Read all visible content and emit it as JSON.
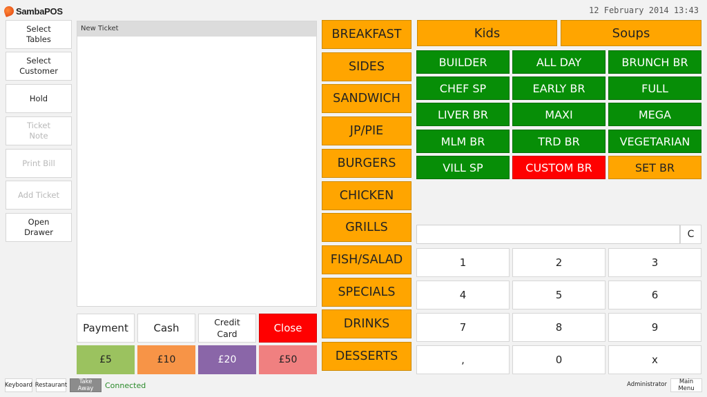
{
  "header": {
    "brand": "SambaPOS",
    "datetime": "12 February 2014 13:43"
  },
  "sidebar": {
    "buttons": [
      {
        "label": "Select\nTables",
        "enabled": true
      },
      {
        "label": "Select\nCustomer",
        "enabled": true
      },
      {
        "label": "Hold",
        "enabled": true
      },
      {
        "label": "Ticket\nNote",
        "enabled": false
      },
      {
        "label": "Print Bill",
        "enabled": false
      },
      {
        "label": "Add Ticket",
        "enabled": false
      },
      {
        "label": "Open\nDrawer",
        "enabled": true
      }
    ]
  },
  "ticket": {
    "title": "New Ticket"
  },
  "payment": {
    "buttons": [
      "Payment",
      "Cash",
      "Credit\nCard",
      "Close"
    ],
    "cash_amounts": [
      "£5",
      "£10",
      "£20",
      "£50"
    ]
  },
  "categories": [
    "BREAKFAST",
    "SIDES",
    "SANDWICH",
    "JP/PIE",
    "BURGERS",
    "CHICKEN",
    "GRILLS",
    "FISH/SALAD",
    "SPECIALS",
    "DRINKS",
    "DESSERTS"
  ],
  "top_categories": [
    "Kids",
    "Soups"
  ],
  "menu_items": [
    "BUILDER",
    "ALL DAY",
    "BRUNCH BR",
    "CHEF SP",
    "EARLY BR",
    "FULL",
    "LIVER BR",
    "MAXI",
    "MEGA",
    "MLM BR",
    "TRD BR",
    "VEGETARIAN",
    "VILL SP",
    "CUSTOM BR",
    "SET BR"
  ],
  "numpad": {
    "input_value": "",
    "clear_label": "C",
    "keys": [
      "1",
      "2",
      "3",
      "4",
      "5",
      "6",
      "7",
      "8",
      "9",
      ",",
      "0",
      "x"
    ]
  },
  "footer": {
    "buttons": [
      "Keyboard",
      "Restaurant",
      "Take Away"
    ],
    "status": "Connected",
    "user": "Administrator",
    "main_menu": "Main Menu"
  },
  "colors": {
    "category": "#ffa500",
    "menu_green": "#078e07",
    "menu_red": "#ff0000",
    "close": "#ff0000",
    "cash5": "#9bc25f",
    "cash10": "#f79447",
    "cash20": "#8a66a8",
    "cash50": "#f08080",
    "status": "#2a8a2a"
  }
}
